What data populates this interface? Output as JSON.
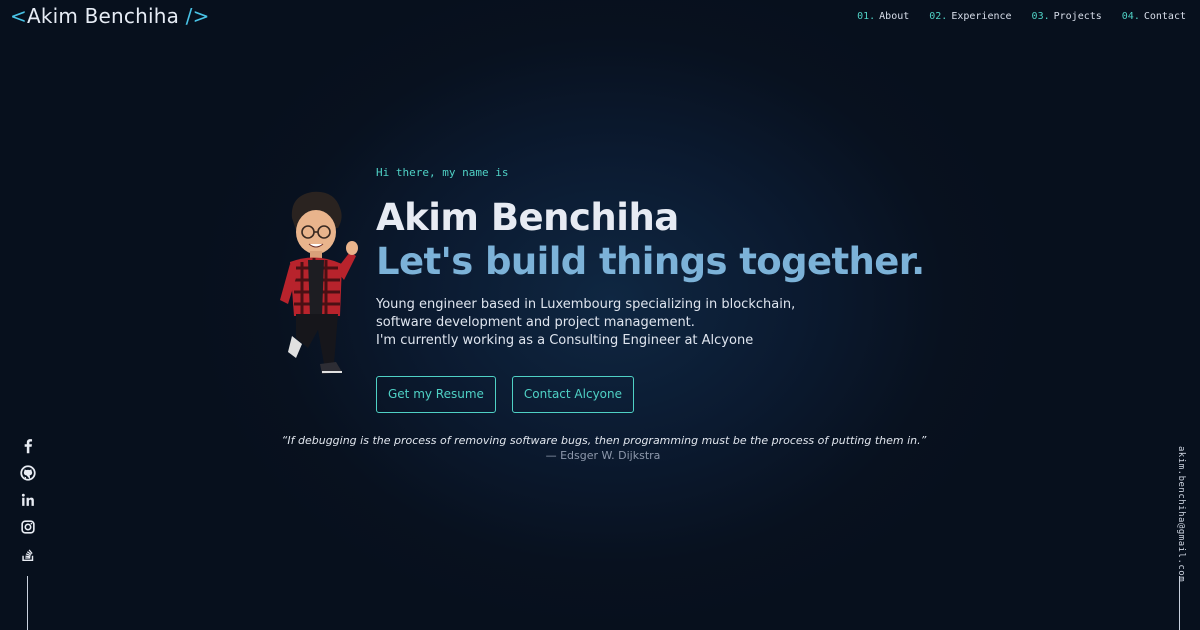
{
  "header": {
    "logo_open": "<",
    "logo_text": "Akim Benchiha",
    "logo_close": "/>",
    "nav": [
      {
        "num": "01.",
        "label": "About"
      },
      {
        "num": "02.",
        "label": "Experience"
      },
      {
        "num": "03.",
        "label": "Projects"
      },
      {
        "num": "04.",
        "label": "Contact"
      }
    ]
  },
  "hero": {
    "greeting": "Hi there, my name is",
    "name": "Akim Benchiha",
    "tagline": "Let's build things together.",
    "description": [
      "Young engineer based in Luxembourg specializing in blockchain,",
      "software development and project management.",
      "I'm currently working as a Consulting Engineer at Alcyone"
    ],
    "buttons": {
      "resume": "Get my Resume",
      "contact": "Contact Alcyone"
    }
  },
  "quote": {
    "text": "“If debugging is the process of removing software bugs, then programming must be the process of putting them in.”",
    "author": "— Edsger W. Dijkstra"
  },
  "social": [
    "facebook-icon",
    "github-icon",
    "linkedin-icon",
    "instagram-icon",
    "stackoverflow-icon"
  ],
  "email": "akim.benchiha@gmail.com",
  "colors": {
    "accent": "#4fd1c5",
    "tagline": "#7cb2d8",
    "background": "#0a1626"
  }
}
